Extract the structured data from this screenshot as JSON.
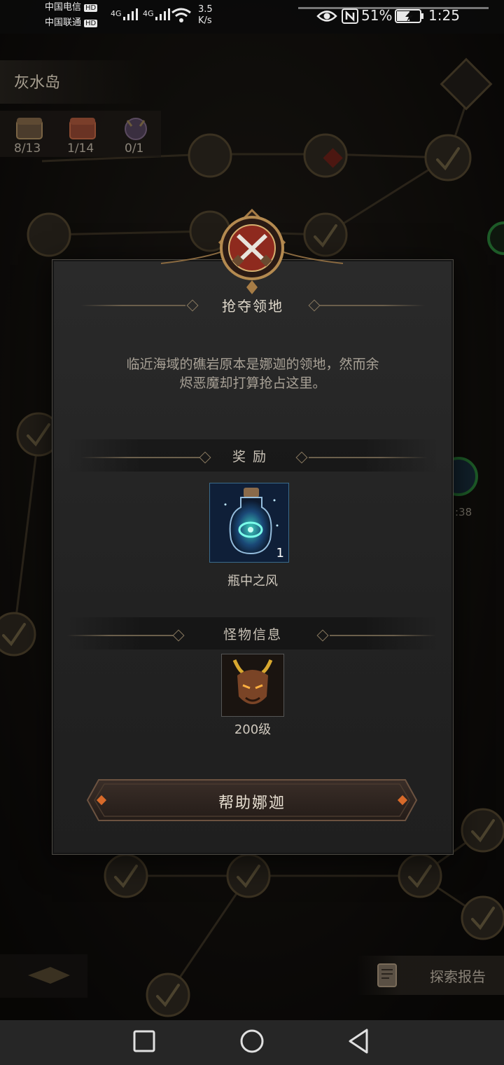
{
  "status_bar": {
    "carrier1": "中国电信",
    "carrier2": "中国联通",
    "hd": "HD",
    "net_type": "4G",
    "speed_value": "3.5",
    "speed_unit": "K/s",
    "battery": "51%",
    "time": "1:25"
  },
  "map": {
    "region_name": "灰水岛",
    "counters": [
      "8/13",
      "1/14",
      "0/1"
    ],
    "side_timer": ":38",
    "report_label": "探索报告"
  },
  "modal": {
    "title": "抢夺领地",
    "description_line1": "临近海域的礁岩原本是娜迦的领地，然而余",
    "description_line2": "烬恶魔却打算抢占这里。",
    "reward_section": "奖励",
    "reward": {
      "name": "瓶中之风",
      "quantity": "1"
    },
    "monster_section": "怪物信息",
    "monster": {
      "level": "200级"
    },
    "action_label": "帮助娜迦"
  },
  "nav": {
    "recent": "recent-apps",
    "home": "home",
    "back": "back"
  }
}
